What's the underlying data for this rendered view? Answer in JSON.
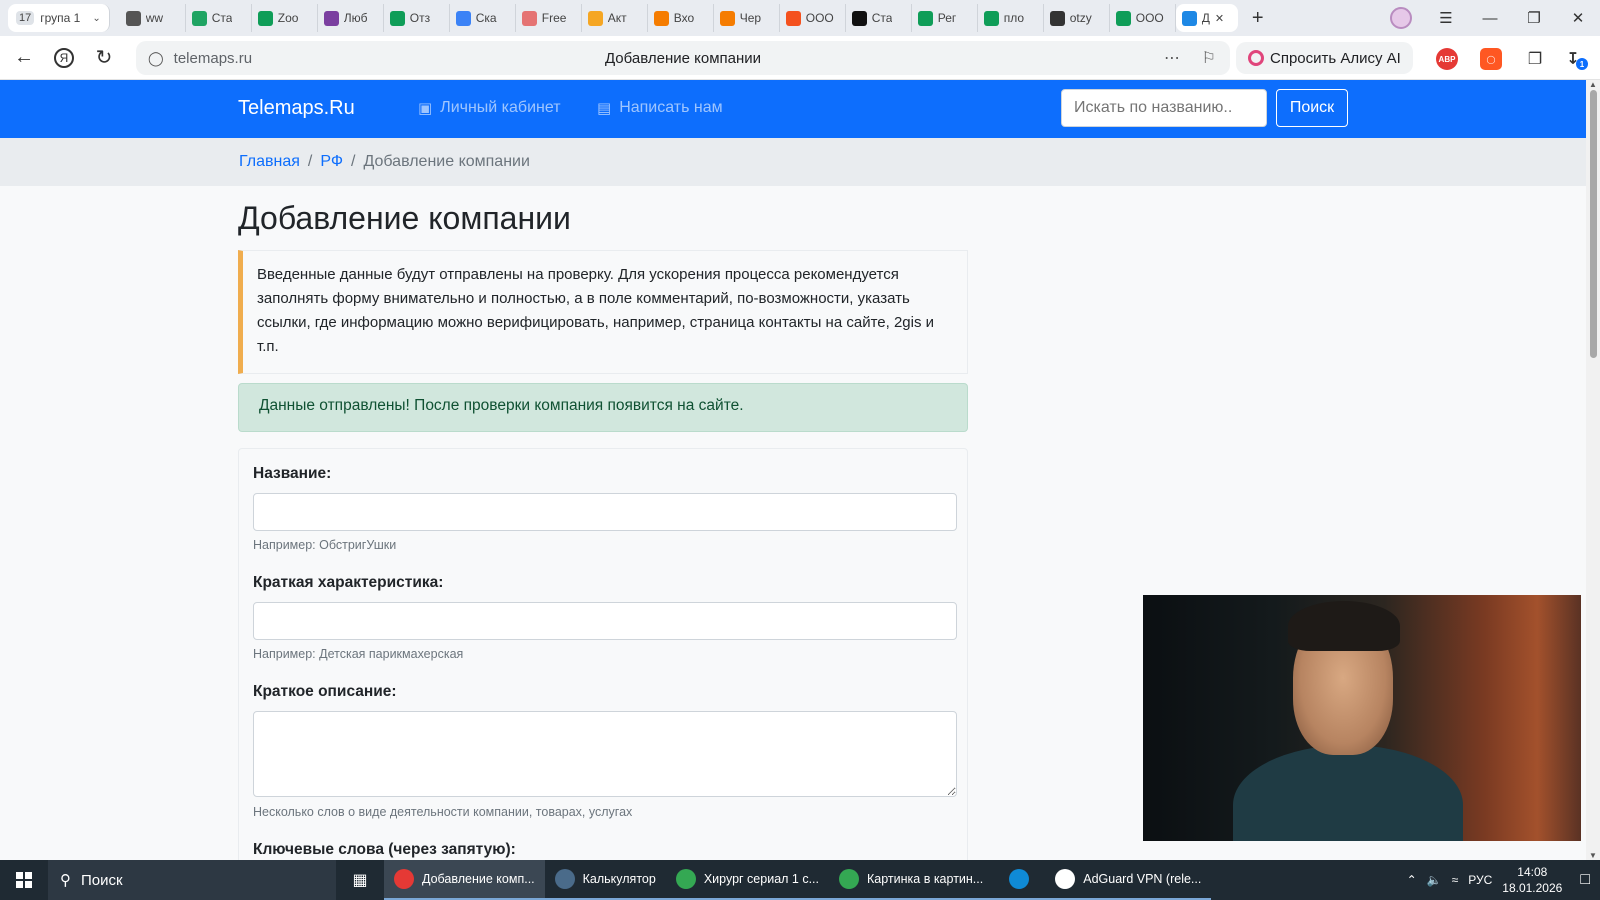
{
  "browser": {
    "tab_group": {
      "count": "17",
      "label": "група 1"
    },
    "tabs": [
      {
        "label": "ww",
        "icon": "doc-icon",
        "color": "#555555"
      },
      {
        "label": "Ста",
        "icon": "drive-icon",
        "color": "#1fa463"
      },
      {
        "label": "Zoo",
        "icon": "sheets-icon",
        "color": "#0f9d58"
      },
      {
        "label": "Люб",
        "icon": "purple-icon",
        "color": "#7b3fa0"
      },
      {
        "label": "Отз",
        "icon": "sheets-icon",
        "color": "#0f9d58"
      },
      {
        "label": "Ска",
        "icon": "diamond-icon",
        "color": "#3b82f6"
      },
      {
        "label": "Free",
        "icon": "free-icon",
        "color": "#e57373"
      },
      {
        "label": "Акт",
        "icon": "chat-icon",
        "color": "#f5a623"
      },
      {
        "label": "Вхо",
        "icon": "mail-icon",
        "color": "#f57c00"
      },
      {
        "label": "Чер",
        "icon": "mail-icon",
        "color": "#f57c00"
      },
      {
        "label": "ООО",
        "icon": "fire-icon",
        "color": "#f4511e"
      },
      {
        "label": "Ста",
        "icon": "k-icon",
        "color": "#111111"
      },
      {
        "label": "Рег",
        "icon": "sheets-icon",
        "color": "#0f9d58"
      },
      {
        "label": "пло",
        "icon": "sheets-icon",
        "color": "#0f9d58"
      },
      {
        "label": "otzy",
        "icon": "loading-icon",
        "color": "#333333"
      },
      {
        "label": "ООО",
        "icon": "sheets-icon",
        "color": "#0f9d58"
      },
      {
        "label": "Д",
        "icon": "shield-icon",
        "color": "#1e88e5"
      }
    ],
    "url": "telemaps.ru",
    "page_title": "Добавление компании",
    "alice_label": "Спросить Алису AI",
    "ext_abp": "ABP",
    "download_badge": "1"
  },
  "site": {
    "brand": "Telemaps.Ru",
    "nav": {
      "cabinet": "Личный кабинет",
      "write": "Написать нам"
    },
    "search": {
      "placeholder": "Искать по названию..",
      "button": "Поиск"
    },
    "breadcrumb": {
      "home": "Главная",
      "region": "РФ",
      "current": "Добавление компании"
    },
    "title": "Добавление компании",
    "notice": "Введенные данные будут отправлены на проверку. Для ускорения процесса рекомендуется заполнять форму внимательно и полностью, а в поле комментарий, по-возможности, указать ссылки, где информацию можно верифицировать, например, страница контакты на сайте, 2gis и т.п.",
    "success": "Данные отправлены! После проверки компания появится на сайте.",
    "form": {
      "name_label": "Название:",
      "name_help": "Например: ОбстригУшки",
      "short_label": "Краткая характеристика:",
      "short_help": "Например: Детская парикмахерская",
      "desc_label": "Краткое описание:",
      "desc_help": "Несколько слов о виде деятельности компании, товарах, услугах",
      "keywords_label": "Ключевые слова (через запятую):"
    }
  },
  "taskbar": {
    "search_label": "Поиск",
    "apps": [
      {
        "label": "Добавление комп...",
        "icon": "yandex-browser-icon",
        "color": "#e53935",
        "active": true
      },
      {
        "label": "Калькулятор",
        "icon": "calculator-icon",
        "color": "#4a6b8a",
        "active": false
      },
      {
        "label": "Хирург сериал 1 с...",
        "icon": "chrome-icon",
        "color": "#34a853",
        "active": false
      },
      {
        "label": "Картинка в картин...",
        "icon": "chrome-icon",
        "color": "#34a853",
        "active": false
      },
      {
        "label": "",
        "icon": "edge-icon",
        "color": "#0f8ad6",
        "active": false
      },
      {
        "label": "AdGuard VPN (rele...",
        "icon": "adguard-icon",
        "color": "#ffffff",
        "active": false
      }
    ],
    "lang": "РУС",
    "time": "14:08",
    "date": "18.01.2026"
  }
}
